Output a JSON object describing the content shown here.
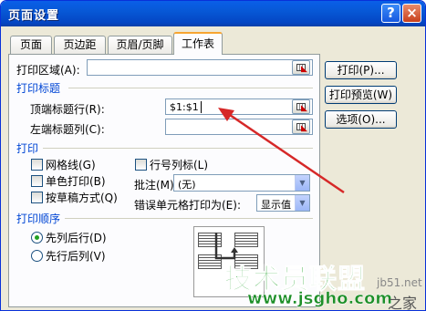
{
  "title": "页面设置",
  "title_buttons": {
    "help": "?",
    "close": "×"
  },
  "tabs": [
    "页面",
    "页边距",
    "页眉/页脚",
    "工作表"
  ],
  "print_area": {
    "label": "打印区域(A):",
    "value": ""
  },
  "print_titles": {
    "section": "打印标题",
    "top_rows_label": "顶端标题行(R):",
    "top_rows_value": "$1:$1",
    "left_cols_label": "左端标题列(C):",
    "left_cols_value": ""
  },
  "print_section": {
    "section": "打印",
    "gridlines": "网格线(G)",
    "mono": "单色打印(B)",
    "draft": "按草稿方式(Q)",
    "row_col_headings": "行号列标(L)",
    "comments_label": "批注(M):",
    "comments_value": "(无)",
    "errors_label": "错误单元格打印为(E):",
    "errors_value": "显示值"
  },
  "page_order": {
    "section": "打印顺序",
    "down_then_over": "先列后行(D)",
    "over_then_down": "先行后列(V)",
    "selected": "down_then_over"
  },
  "buttons": {
    "print": "打印(P)...",
    "preview": "打印预览(W)",
    "options": "选项(O)..."
  },
  "watermark": {
    "name": "技术员联盟",
    "url": "www.jsgho.com",
    "site_small": "jb51.net",
    "tail": "之家"
  },
  "colors": {
    "title_bar": "#0758d6",
    "dialog_bg": "#ece9d8",
    "section_text": "#0046d5",
    "annotation_arrow": "#d62828",
    "watermark_green": "#2fa838"
  },
  "icons": {
    "ref_button": "collapse-dialog-icon",
    "dropdown": "chevron-down-icon",
    "order_preview": "page-order-diagram-icon"
  }
}
